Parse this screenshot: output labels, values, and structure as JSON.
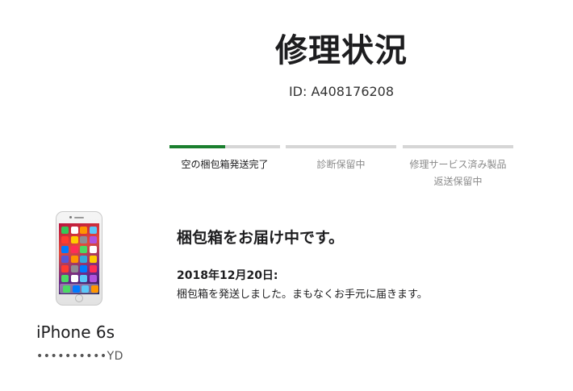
{
  "header": {
    "title": "修理状況",
    "repair_id": "ID: A408176208"
  },
  "progress": {
    "steps": [
      {
        "label": "空の梱包箱発送完了",
        "state": "active",
        "fill": 0.5
      },
      {
        "label": "診断保留中",
        "state": "pending",
        "fill": 0
      },
      {
        "label": "修理サービス済み製品\n返送保留中",
        "state": "pending",
        "fill": 0
      }
    ],
    "accent_color": "#1a7f2e",
    "track_color": "#d6d6d6"
  },
  "device": {
    "name": "iPhone 6s",
    "serial": "••••••••••YD",
    "image_icon": "iphone-icon"
  },
  "status": {
    "heading": "梱包箱をお届け中です。",
    "date": "2018年12月20日:",
    "message": "梱包箱を発送しました。まもなくお手元に届きます。"
  }
}
